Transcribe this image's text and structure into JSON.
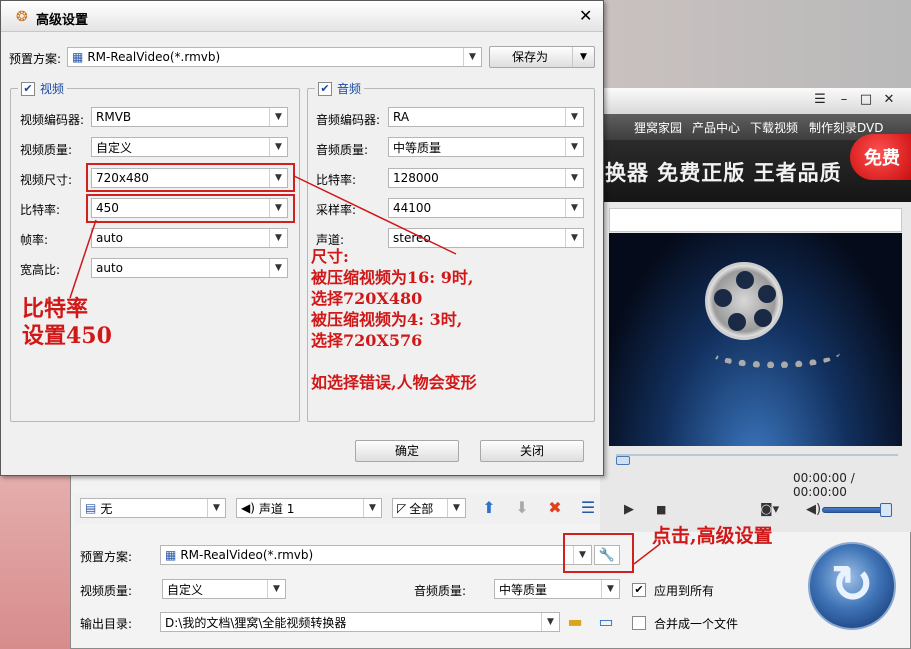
{
  "main_window": {
    "nav_links": [
      "狸窝家园",
      "产品中心",
      "下载视频",
      "制作刻录DVD"
    ],
    "window_controls": [
      "menu-icon",
      "minimize-icon",
      "maximize-icon",
      "close-icon"
    ],
    "banner_text": "换器  免费正版  王者品质",
    "free_badge": "免费",
    "time_display": "00:00:00 / 00:00:00",
    "toolbar": {
      "subtitle_value": "无",
      "audio_track_value": "声道 1",
      "range_value": "全部"
    },
    "preset_label": "预置方案:",
    "preset_value": "RM-RealVideo(*.rmvb)",
    "video_quality_label": "视频质量:",
    "video_quality_value": "自定义",
    "audio_quality_label": "音频质量:",
    "audio_quality_value": "中等质量",
    "apply_all_label": "应用到所有",
    "apply_all_checked": true,
    "output_label": "输出目录:",
    "output_path": "D:\\我的文档\\狸窝\\全能视频转换器",
    "merge_label": "合并成一个文件",
    "merge_checked": false
  },
  "dialog": {
    "title": "高级设置",
    "preset_label": "预置方案:",
    "preset_value": "RM-RealVideo(*.rmvb)",
    "save_as": "保存为",
    "video_group": {
      "title": "视频",
      "checked": true,
      "fields": [
        {
          "label": "视频编码器:",
          "value": "RMVB"
        },
        {
          "label": "视频质量:",
          "value": "自定义"
        },
        {
          "label": "视频尺寸:",
          "value": "720x480"
        },
        {
          "label": "比特率:",
          "value": "450"
        },
        {
          "label": "帧率:",
          "value": "auto"
        },
        {
          "label": "宽高比:",
          "value": "auto"
        }
      ]
    },
    "audio_group": {
      "title": "音频",
      "checked": true,
      "fields": [
        {
          "label": "音频编码器:",
          "value": "RA"
        },
        {
          "label": "音频质量:",
          "value": "中等质量"
        },
        {
          "label": "比特率:",
          "value": "128000"
        },
        {
          "label": "采样率:",
          "value": "44100"
        },
        {
          "label": "声道:",
          "value": "stereo"
        }
      ]
    },
    "ok_button": "确定",
    "close_button": "关闭"
  },
  "annotations": {
    "bitrate_note": [
      "比特率",
      "设置450"
    ],
    "size_note": [
      "尺寸:",
      "被压缩视频为16: 9时,",
      "选择720X480",
      "被压缩视频为4: 3时,",
      "选择720X576",
      "",
      "如选择错误,人物会变形"
    ],
    "advanced_note": "点击,高级设置"
  },
  "colors": {
    "annotation_red": "#d01818",
    "group_title_blue": "#1a47a0",
    "nav_bar": "#4a4a4a",
    "convert_button": "#3f74b7"
  }
}
